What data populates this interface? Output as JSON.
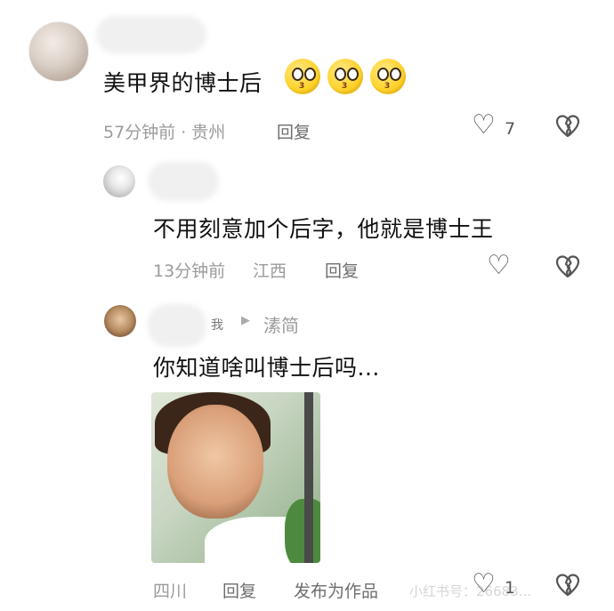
{
  "comments": [
    {
      "text": "美甲界的博士后",
      "emoji_icon": "kissing-face-emoji",
      "emoji_count": 3,
      "time": "57分钟前 · 贵州",
      "reply_label": "回复",
      "likes": "7"
    },
    {
      "text": "不用刻意加个后字，他就是博士王",
      "time": "13分钟前",
      "location": "江西",
      "reply_label": "回复"
    },
    {
      "author_tag": "我",
      "reply_to": "溸简",
      "text": "你知道啥叫博士后吗...",
      "location": "四川",
      "reply_label": "回复",
      "publish_label": "发布为作品",
      "likes": "1"
    }
  ],
  "icons": {
    "like": "heart-outline-icon",
    "dislike": "broken-heart-icon",
    "reply_arrow": "play-arrow-icon"
  },
  "watermark": "小红书号：26683..."
}
